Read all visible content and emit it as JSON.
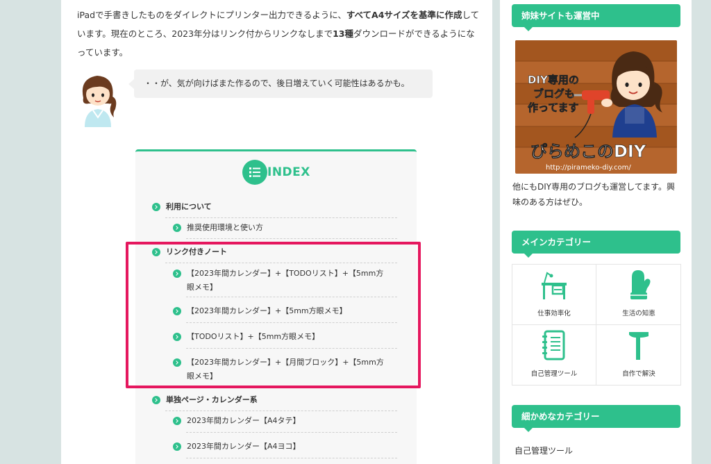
{
  "intro": {
    "p1": "iPadで手書きしたものをダイレクトにプリンター出力できるように、",
    "b1": "すべてA4サイズを基準に作成",
    "p2": "しています。現在のところ、2023年分はリンク付からリンクなしまで",
    "b2": "13種",
    "p3": "ダウンロードができるようになっています。"
  },
  "bubble": {
    "text": "・・が、気が向けばまた作るので、後日増えていく可能性はあるかも。"
  },
  "toc": {
    "title": "INDEX",
    "items": [
      {
        "label": "利用について",
        "level": 1
      },
      {
        "label": "推奨使用環境と使い方",
        "level": 2
      },
      {
        "label": "リンク付きノート",
        "level": 1
      },
      {
        "label": "【2023年間カレンダー】+【TODOリスト】+【5mm方",
        "label2": "眼メモ】",
        "level": 2
      },
      {
        "label": "【2023年間カレンダー】+【5mm方眼メモ】",
        "level": 2
      },
      {
        "label": "【TODOリスト】+【5mm方眼メモ】",
        "level": 2
      },
      {
        "label": "【2023年間カレンダー】+【月間ブロック】+【5mm方",
        "label2": "眼メモ】",
        "level": 2
      },
      {
        "label": "単独ページ・カレンダー系",
        "level": 1
      },
      {
        "label": "2023年間カレンダー【A4タテ】",
        "level": 2
      },
      {
        "label": "2023年間カレンダー【A4ヨコ】",
        "level": 2
      }
    ]
  },
  "sidebar": {
    "sister_heading": "姉妹サイトも運営中",
    "banner": {
      "line1": "DIY専用の",
      "line2": "ブログも",
      "line3": "作ってます",
      "logo": "ぴらめこのDIY",
      "url": "http://pirameko-diy.com/"
    },
    "sister_text": "他にもDIY専用のブログも運営してます。興味のある方はぜひ。",
    "main_cat_heading": "メインカテゴリー",
    "main_categories": [
      {
        "label": "仕事効率化",
        "icon": "desk-icon"
      },
      {
        "label": "生活の知恵",
        "icon": "mitten-icon"
      },
      {
        "label": "自己管理ツール",
        "icon": "notebook-icon"
      },
      {
        "label": "自作で解決",
        "icon": "hammer-icon"
      }
    ],
    "fine_cat_heading": "細かめなカテゴリー",
    "fine_categories": [
      {
        "label": "自己管理ツール"
      }
    ]
  },
  "colors": {
    "accent": "#2ec08c",
    "highlight": "#e5175e",
    "background": "#d7e3e2"
  }
}
